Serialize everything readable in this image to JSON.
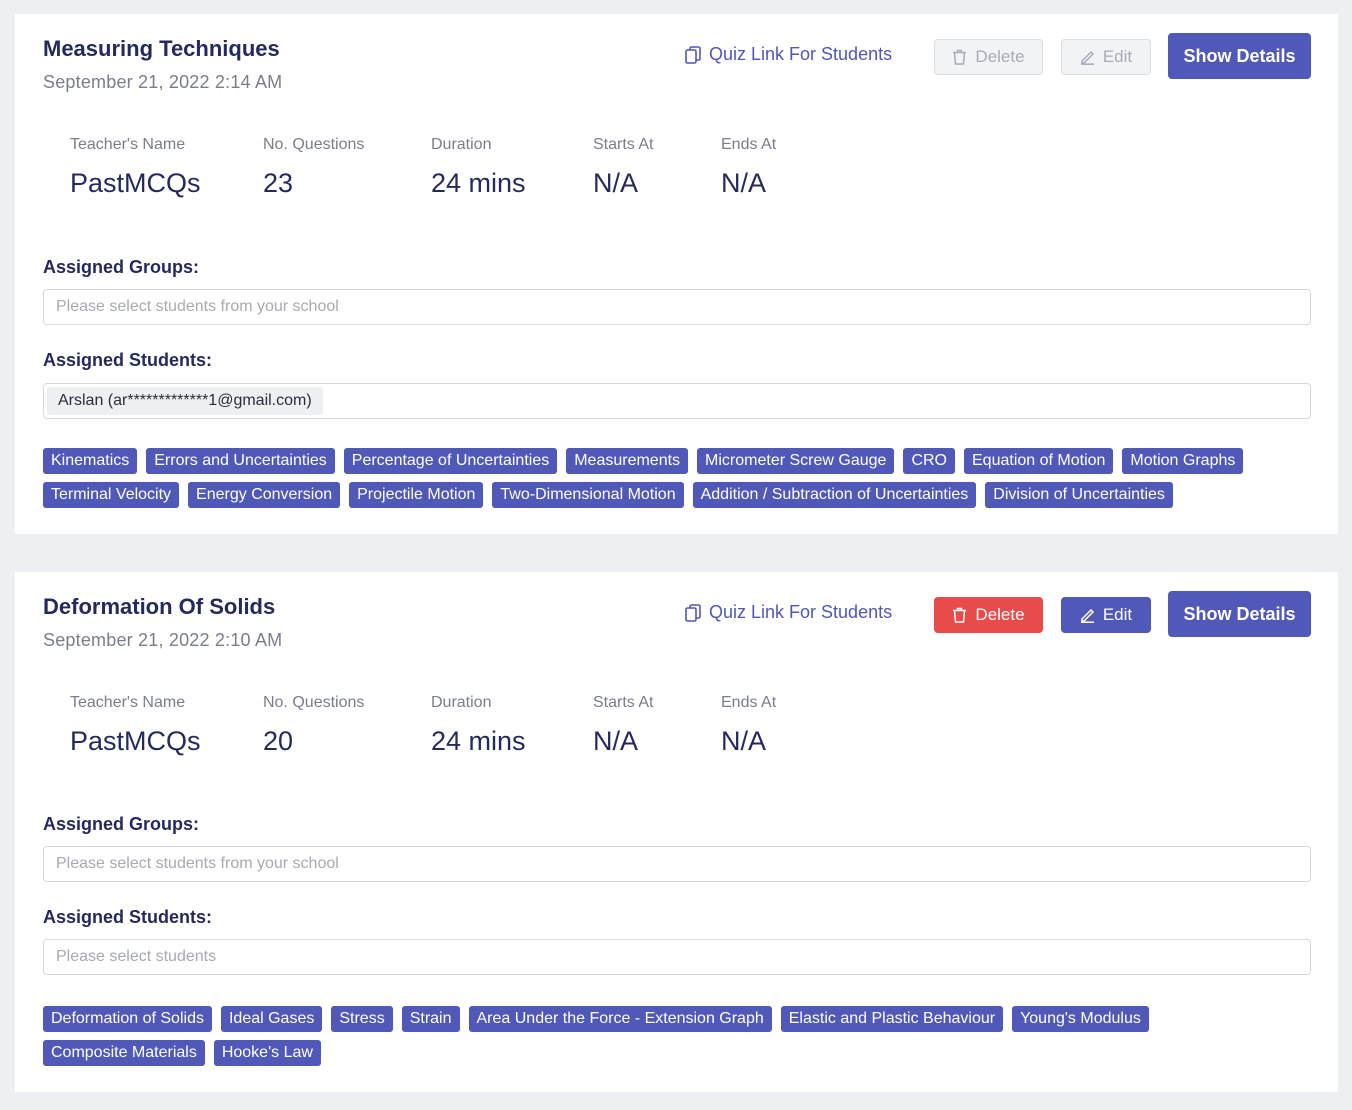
{
  "quizzes": [
    {
      "title": "Measuring Techniques",
      "date": "September 21, 2022 2:14 AM",
      "quiz_link_label": "Quiz Link For Students",
      "delete_label": "Delete",
      "edit_label": "Edit",
      "show_details_label": "Show Details",
      "actions_enabled": false,
      "stats": {
        "teacher_label": "Teacher's Name",
        "teacher_value": "PastMCQs",
        "questions_label": "No. Questions",
        "questions_value": "23",
        "duration_label": "Duration",
        "duration_value": "24 mins",
        "starts_label": "Starts At",
        "starts_value": "N/A",
        "ends_label": "Ends At",
        "ends_value": "N/A"
      },
      "groups_label": "Assigned Groups:",
      "groups_placeholder": "Please select students from your school",
      "students_label": "Assigned Students:",
      "students_chip": "Arslan (ar*************1@gmail.com)",
      "students_placeholder": "",
      "tags": [
        "Kinematics",
        "Errors and Uncertainties",
        "Percentage of Uncertainties",
        "Measurements",
        "Micrometer Screw Gauge",
        "CRO",
        "Equation of Motion",
        "Motion Graphs",
        "Terminal Velocity",
        "Energy Conversion",
        "Projectile Motion",
        "Two-Dimensional Motion",
        "Addition / Subtraction of Uncertainties",
        "Division of Uncertainties"
      ]
    },
    {
      "title": "Deformation Of Solids",
      "date": "September 21, 2022 2:10 AM",
      "quiz_link_label": "Quiz Link For Students",
      "delete_label": "Delete",
      "edit_label": "Edit",
      "show_details_label": "Show Details",
      "actions_enabled": true,
      "stats": {
        "teacher_label": "Teacher's Name",
        "teacher_value": "PastMCQs",
        "questions_label": "No. Questions",
        "questions_value": "20",
        "duration_label": "Duration",
        "duration_value": "24 mins",
        "starts_label": "Starts At",
        "starts_value": "N/A",
        "ends_label": "Ends At",
        "ends_value": "N/A"
      },
      "groups_label": "Assigned Groups:",
      "groups_placeholder": "Please select students from your school",
      "students_label": "Assigned Students:",
      "students_chip": "",
      "students_placeholder": "Please select students",
      "tags": [
        "Deformation of Solids",
        "Ideal Gases",
        "Stress",
        "Strain",
        "Area Under the Force - Extension Graph",
        "Elastic and Plastic Behaviour",
        "Young's Modulus",
        "Composite Materials",
        "Hooke's Law"
      ]
    }
  ],
  "colors": {
    "primary": "#5059b8",
    "danger": "#e94b4b",
    "background": "#eeeff3"
  },
  "icons": {
    "quiz_link": "copy-icon",
    "delete": "trash-icon",
    "edit": "pencil-icon"
  }
}
